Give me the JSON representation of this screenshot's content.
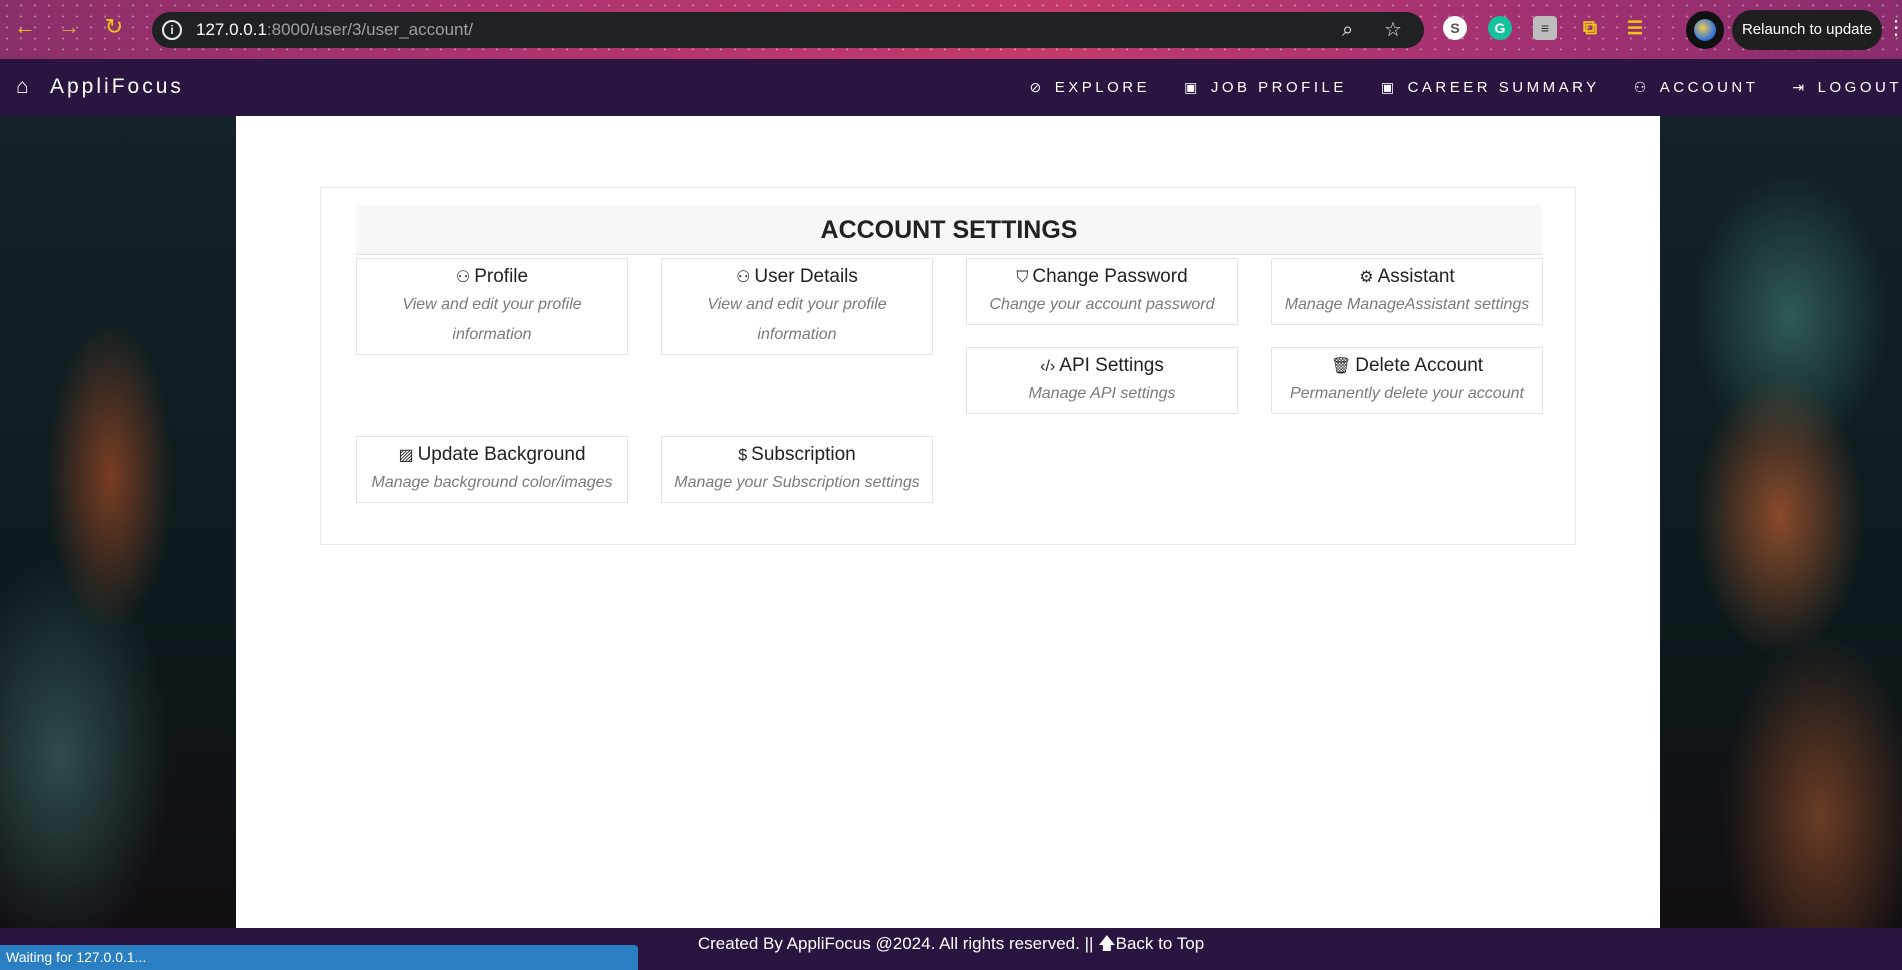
{
  "browser": {
    "url_host": "127.0.0.1",
    "url_path": ":8000/user/3/user_account/",
    "relaunch_label": "Relaunch to update"
  },
  "nav": {
    "brand": "AppliFocus",
    "items": [
      {
        "label": "EXPLORE",
        "icon": "compass-icon"
      },
      {
        "label": "JOB PROFILE",
        "icon": "briefcase-icon"
      },
      {
        "label": "CAREER SUMMARY",
        "icon": "briefcase-icon"
      },
      {
        "label": "ACCOUNT",
        "icon": "user-icon"
      },
      {
        "label": "LOGOUT",
        "icon": "logout-icon"
      }
    ]
  },
  "settings": {
    "title": "ACCOUNT SETTINGS",
    "tiles": [
      {
        "title": "Profile",
        "desc": "View and edit your profile information",
        "icon": "user-icon"
      },
      {
        "title": "User Details",
        "desc": "View and edit your profile information",
        "icon": "user-icon"
      },
      {
        "title": "Change Password",
        "desc": "Change your account password",
        "icon": "shield-icon"
      },
      {
        "title": "Assistant",
        "desc": "Manage ManageAssistant settings",
        "icon": "gear-icon"
      },
      {
        "title": "API Settings",
        "desc": "Manage API settings",
        "icon": "code-icon"
      },
      {
        "title": "Delete Account",
        "desc": "Permanently delete your account",
        "icon": "trash-icon"
      },
      {
        "title": "Update Background",
        "desc": "Manage background color/images",
        "icon": "image-icon"
      },
      {
        "title": "Subscription",
        "desc": "Manage your Subscription settings",
        "icon": "dollar-icon"
      }
    ]
  },
  "footer": {
    "text": "Created By AppliFocus @2024. All rights reserved. ||",
    "back_to_top": "Back to Top"
  },
  "status_bar": "Waiting for 127.0.0.1..."
}
